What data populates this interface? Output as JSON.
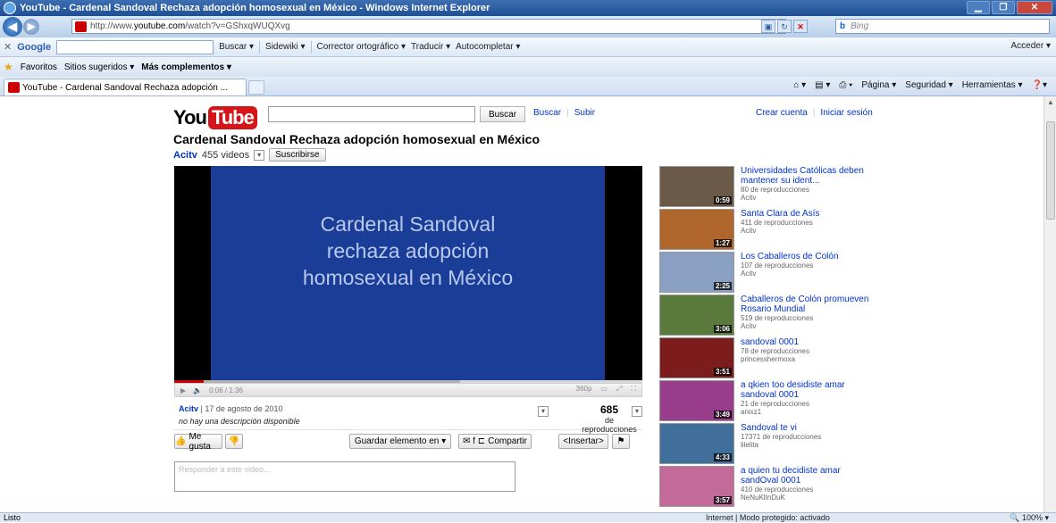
{
  "window": {
    "title": "YouTube - Cardenal Sandoval Rechaza adopción homosexual en México - Windows Internet Explorer",
    "buttons": [
      "▁",
      "❐",
      "✕"
    ]
  },
  "address": {
    "url_prefix": "http://www.",
    "url_domain": "youtube.com",
    "url_path": "/watch?v=GShxqWUQXvg",
    "search_engine": "Bing"
  },
  "google_toolbar": {
    "close": "✕",
    "logo": "Google",
    "items": [
      "Buscar ▾",
      "Sidewiki ▾",
      "Corrector ortográfico ▾",
      "Traducir ▾",
      "Autocompletar ▾"
    ],
    "signin": "Acceder ▾"
  },
  "favorites_bar": {
    "favorites": "Favoritos",
    "suggested": "Sitios sugeridos ▾",
    "more": "Más complementos ▾"
  },
  "tab": {
    "label": "YouTube - Cardenal Sandoval Rechaza adopción ..."
  },
  "command_bar": [
    "Página ▾",
    "Seguridad ▾",
    "Herramientas ▾"
  ],
  "youtube": {
    "logo_you": "You",
    "logo_tube": "Tube",
    "search_value": "",
    "search_button": "Buscar",
    "nav_links": [
      "Buscar",
      "Subir"
    ],
    "account_links": [
      "Crear cuenta",
      "Iniciar sesión"
    ]
  },
  "video": {
    "title": "Cardenal Sandoval Rechaza adopción homosexual en México",
    "channel": "Acitv",
    "video_count": "455 videos",
    "subscribe": "Suscribirse",
    "slide_lines": [
      "Cardenal Sandoval",
      "rechaza adopción",
      "homosexual en México"
    ],
    "time": "0:06 / 1:36",
    "quality": "360p",
    "progress_fraction": 0.0625,
    "uploader": "Acitv",
    "upload_date": "17 de agosto de 2010",
    "description": "no hay una descripción disponible",
    "views": "685",
    "views_label": "de reproducciones"
  },
  "actions": {
    "like": "Me gusta",
    "save": "Guardar elemento en ▾",
    "share": "Compartir",
    "embed": "<Insertar>"
  },
  "comment": {
    "placeholder": "Responder a este video..."
  },
  "related": [
    {
      "title": "Universidades Católicas deben mantener su ident...",
      "views": "80 de reproducciones",
      "user": "Acitv",
      "duration": "0:59",
      "thumb": "#6b5a48"
    },
    {
      "title": "Santa Clara de Asís",
      "views": "411 de reproducciones",
      "user": "Acitv",
      "duration": "1:27",
      "thumb": "#b0662a"
    },
    {
      "title": "Los Caballeros de Colón",
      "views": "107 de reproducciones",
      "user": "Acitv",
      "duration": "2:25",
      "thumb": "#8aa0c2"
    },
    {
      "title": "Caballeros de Colón promueven Rosario Mundial",
      "views": "519 de reproducciones",
      "user": "Acitv",
      "duration": "3:06",
      "thumb": "#5a7a3c"
    },
    {
      "title": "sandoval 0001",
      "views": "78 de reproducciones",
      "user": "princesshermoxa",
      "duration": "3:51",
      "thumb": "#7d1c1c"
    },
    {
      "title": "a qkien too desidiste amar sandoval 0001",
      "views": "21 de reproducciones",
      "user": "anixz1",
      "duration": "3:49",
      "thumb": "#9a3c8c"
    },
    {
      "title": "Sandoval te vi",
      "views": "17371 de reproducciones",
      "user": "lilelita",
      "duration": "4:33",
      "thumb": "#3f6f9a"
    },
    {
      "title": "a quien tu decidiste amar sandOval 0001",
      "views": "410 de reproducciones",
      "user": "NeNuKlInDuK",
      "duration": "3:57",
      "thumb": "#c46a9a"
    }
  ],
  "status": {
    "left": "Listo",
    "zone": "Internet | Modo protegido: activado",
    "zoom": "🔍 100% ▾"
  }
}
